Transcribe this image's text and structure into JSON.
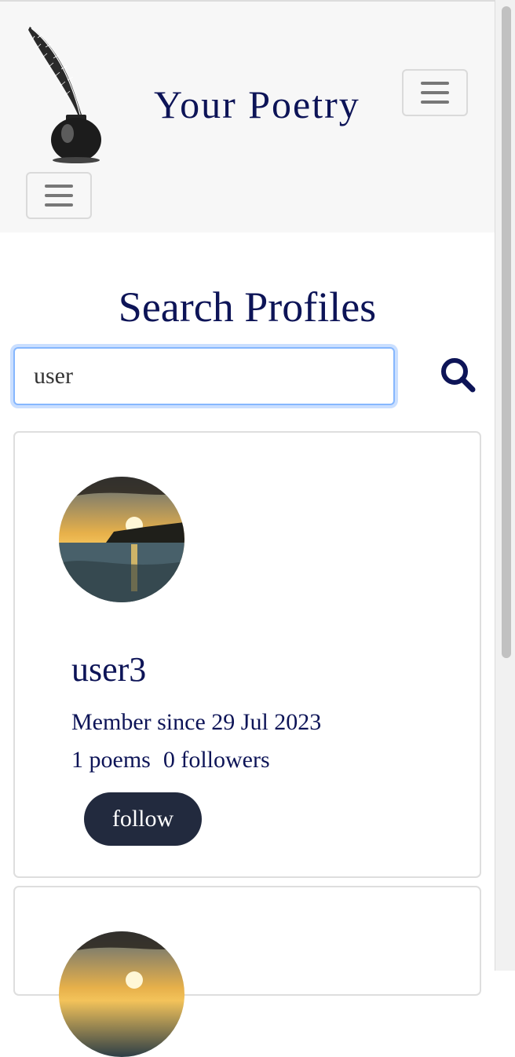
{
  "header": {
    "site_title": "Your Poetry",
    "logo_icon": "quill-inkwell-icon",
    "menu_icon": "hamburger-icon"
  },
  "search": {
    "title": "Search Profiles",
    "query": "user",
    "button_icon": "search-icon"
  },
  "profiles": [
    {
      "username": "user3",
      "member_since": "Member since 29 Jul 2023",
      "poems": "1 poems",
      "followers": "0 followers",
      "follow_label": "follow"
    }
  ],
  "colors": {
    "accent": "#0d1457",
    "header_bg": "#f7f7f7",
    "follow_button": "#222a3e"
  }
}
